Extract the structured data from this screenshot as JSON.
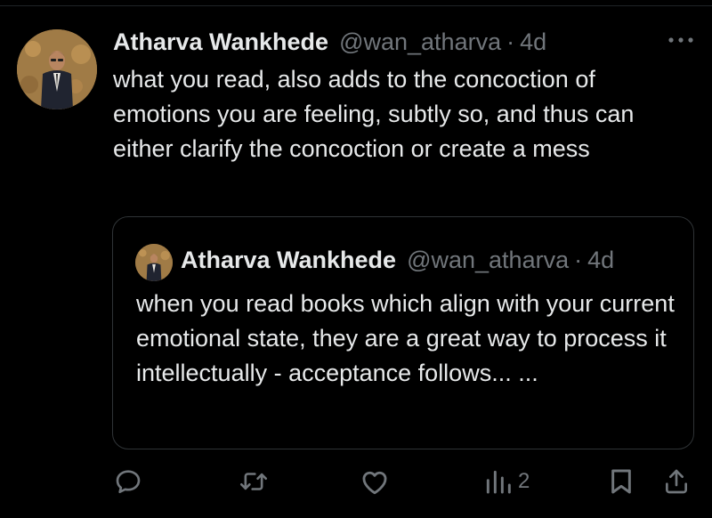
{
  "post": {
    "author_name": "Atharva Wankhede",
    "handle": "@wan_atharva",
    "separator": "·",
    "time": "4d",
    "text": "what you read, also adds to the concoction of emotions you are feeling, subtly so, and thus can either clarify the concoction or create a mess",
    "more_icon": "more-horizontal-icon"
  },
  "quoted_post": {
    "author_name": "Atharva Wankhede",
    "handle": "@wan_atharva",
    "separator": "·",
    "time": "4d",
    "text": "when you read books which align with your current emotional state, they are a great way to process it intellectually - acceptance follows... ..."
  },
  "actions": {
    "reply_icon": "reply-icon",
    "repost_icon": "repost-icon",
    "like_icon": "heart-icon",
    "views_icon": "views-icon",
    "views_count": "2",
    "bookmark_icon": "bookmark-icon",
    "share_icon": "share-icon"
  },
  "colors": {
    "background": "#000000",
    "text_primary": "#e7e9ea",
    "text_secondary": "#71767b",
    "border": "#2f3336"
  }
}
